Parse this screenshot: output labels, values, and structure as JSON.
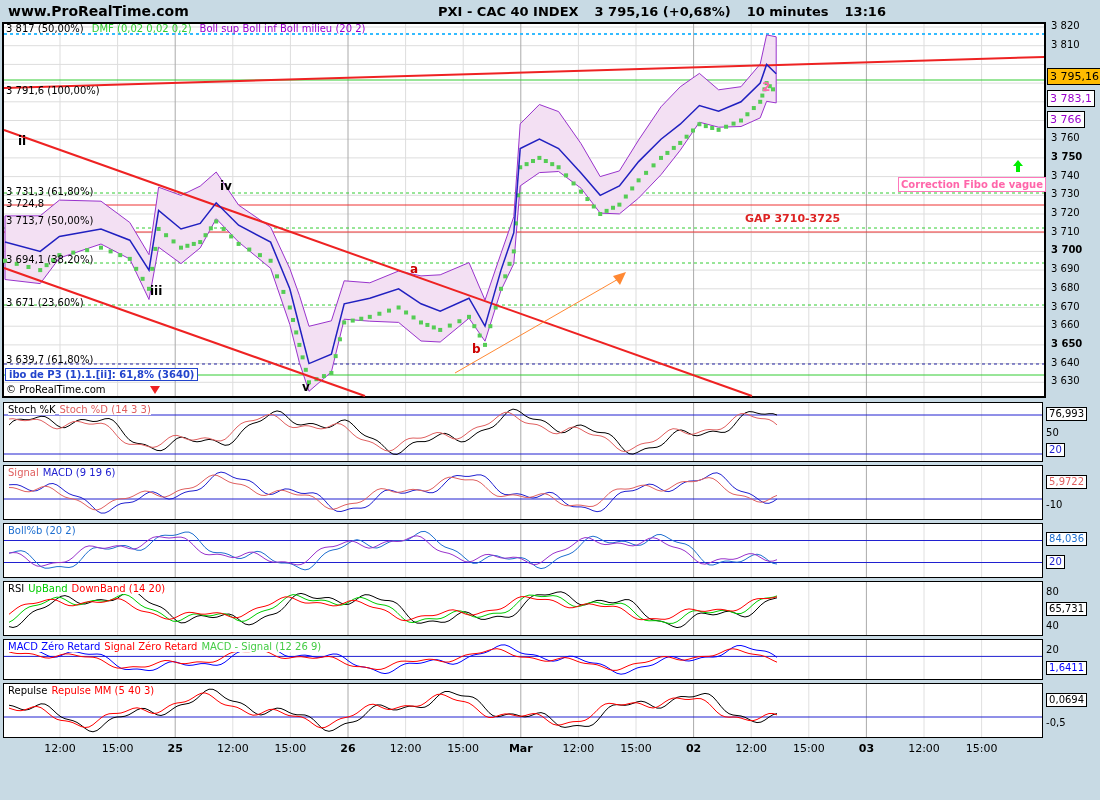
{
  "header": {
    "site": "www.ProRealTime.com",
    "title": "PXI - CAC 40 INDEX",
    "price": "3 795,16 (+0,68%)",
    "interval": "10 minutes",
    "time": "13:16"
  },
  "main": {
    "legend": [
      {
        "text": "3 817 (50,00%)",
        "color": "#000000"
      },
      {
        "text": "DMF (0,02 0,02 0,2)",
        "color": "#33cc33"
      },
      {
        "text": "Boll sup Boll inf Boll milieu (20 2)",
        "color": "#9900cc"
      }
    ],
    "fib_labels": [
      "3 791,6 (100,00%)",
      "3 731,3 (61,80%)",
      "3 724,8",
      "3 713,7 (50,00%)",
      "3 694,1 (38,20%)",
      "3 671 (23,60%)",
      "3 639,7 (61,80%)"
    ],
    "fib_box": "ibo de P3 (1).1.[ii]: 61,8% (3640)",
    "gap_label": "GAP 3710-3725",
    "correction_label": "Correction Fibo de vague",
    "copyright": "© ProRealTime.com",
    "wave_labels": [
      {
        "text": "ii",
        "color": "#000000"
      },
      {
        "text": "iv",
        "color": "#000000"
      },
      {
        "text": "iii",
        "color": "#000000"
      },
      {
        "text": "v",
        "color": "#000000"
      },
      {
        "text": "a",
        "color": "#cc0000"
      },
      {
        "text": "b",
        "color": "#cc0000"
      },
      {
        "text": "2",
        "color": "#ff66aa"
      }
    ],
    "price_axis": [
      {
        "text": "3 820",
        "kind": "minor"
      },
      {
        "text": "3 810",
        "kind": "minor"
      },
      {
        "text": "3 760",
        "kind": "minor"
      },
      {
        "text": "3 750",
        "kind": "major"
      },
      {
        "text": "3 740",
        "kind": "minor"
      },
      {
        "text": "3 730",
        "kind": "minor"
      },
      {
        "text": "3 720",
        "kind": "minor"
      },
      {
        "text": "3 710",
        "kind": "minor"
      },
      {
        "text": "3 700",
        "kind": "major"
      },
      {
        "text": "3 690",
        "kind": "minor"
      },
      {
        "text": "3 680",
        "kind": "minor"
      },
      {
        "text": "3 670",
        "kind": "minor"
      },
      {
        "text": "3 660",
        "kind": "minor"
      },
      {
        "text": "3 650",
        "kind": "major"
      },
      {
        "text": "3 640",
        "kind": "minor"
      },
      {
        "text": "3 630",
        "kind": "minor"
      }
    ],
    "readouts": [
      {
        "text": "3 795,16",
        "color": "#000000",
        "kind": "current"
      },
      {
        "text": "3 783,1",
        "color": "#9900cc",
        "kind": "level"
      },
      {
        "text": "3 766",
        "color": "#9900cc",
        "kind": "level"
      }
    ]
  },
  "indicators": [
    {
      "kind": "stochastic",
      "legend": [
        {
          "text": "Stoch %K",
          "color": "#000000"
        },
        {
          "text": "Stoch %D (14 3 3)",
          "color": "#e06060"
        }
      ],
      "axis": [
        {
          "text": "76,993",
          "kind": "reading",
          "color": "#000000"
        },
        {
          "text": "50",
          "kind": "tick"
        },
        {
          "text": "20",
          "kind": "reading",
          "color": "#2020d0"
        }
      ]
    },
    {
      "kind": "macd",
      "legend": [
        {
          "text": "Signal",
          "color": "#e06060"
        },
        {
          "text": "MACD (9 19 6)",
          "color": "#2020d0"
        }
      ],
      "axis": [
        {
          "text": "5,9722",
          "kind": "reading",
          "color": "#e06060"
        },
        {
          "text": "-10",
          "kind": "tick"
        }
      ]
    },
    {
      "kind": "bollinger",
      "legend": [
        {
          "text": "Boll%b (20 2)",
          "color": "#1e6fd0"
        }
      ],
      "axis": [
        {
          "text": "84,036",
          "kind": "reading",
          "color": "#1e6fd0"
        },
        {
          "text": "20",
          "kind": "reading",
          "color": "#2020d0"
        }
      ]
    },
    {
      "kind": "rsi",
      "legend": [
        {
          "text": "RSI",
          "color": "#000000"
        },
        {
          "text": "UpBand",
          "color": "#00cc00"
        },
        {
          "text": "DownBand (14 20)",
          "color": "#ff0000"
        }
      ],
      "axis": [
        {
          "text": "80",
          "kind": "tick"
        },
        {
          "text": "65,731",
          "kind": "reading",
          "color": "#000000"
        },
        {
          "text": "40",
          "kind": "tick"
        }
      ]
    },
    {
      "kind": "macd_zero",
      "legend": [
        {
          "text": "MACD Zéro Retard",
          "color": "#0000ff"
        },
        {
          "text": "Signal Zéro Retard",
          "color": "#ff0000"
        },
        {
          "text": "MACD - Signal (12 26 9)",
          "color": "#44cc44"
        }
      ],
      "axis": [
        {
          "text": "20",
          "kind": "tick"
        },
        {
          "text": "1,6411",
          "kind": "reading",
          "color": "#0000ff"
        }
      ]
    },
    {
      "kind": "repulse",
      "legend": [
        {
          "text": "Repulse",
          "color": "#000000"
        },
        {
          "text": "Repulse MM (5 40 3)",
          "color": "#ff0000"
        }
      ],
      "axis": [
        {
          "text": "0,0694",
          "kind": "reading",
          "color": "#000000"
        },
        {
          "text": "-0,5",
          "kind": "tick"
        }
      ]
    }
  ],
  "time_axis": [
    {
      "text": "12:00",
      "kind": "hour"
    },
    {
      "text": "15:00",
      "kind": "hour"
    },
    {
      "text": "25",
      "kind": "day"
    },
    {
      "text": "12:00",
      "kind": "hour"
    },
    {
      "text": "15:00",
      "kind": "hour"
    },
    {
      "text": "26",
      "kind": "day"
    },
    {
      "text": "12:00",
      "kind": "hour"
    },
    {
      "text": "15:00",
      "kind": "hour"
    },
    {
      "text": "Mar",
      "kind": "day"
    },
    {
      "text": "12:00",
      "kind": "hour"
    },
    {
      "text": "15:00",
      "kind": "hour"
    },
    {
      "text": "02",
      "kind": "day"
    },
    {
      "text": "12:00",
      "kind": "hour"
    },
    {
      "text": "15:00",
      "kind": "hour"
    },
    {
      "text": "03",
      "kind": "day"
    },
    {
      "text": "12:00",
      "kind": "hour"
    },
    {
      "text": "15:00",
      "kind": "hour"
    }
  ]
}
